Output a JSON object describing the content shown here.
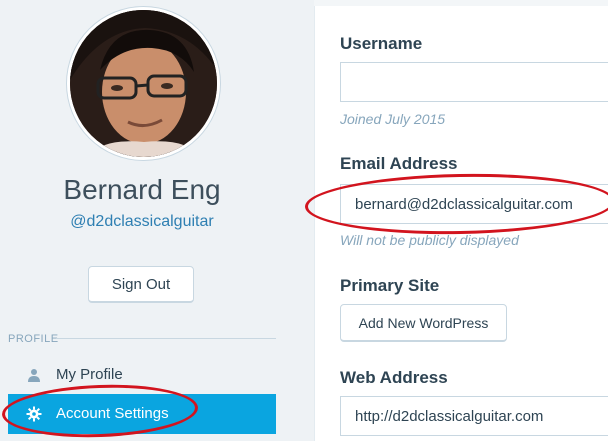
{
  "profile": {
    "display_name": "Bernard Eng",
    "handle": "@d2dclassicalguitar",
    "sign_out_label": "Sign Out"
  },
  "sidebar": {
    "section_label": "PROFILE",
    "items": [
      {
        "label": "My Profile",
        "icon": "person-icon"
      },
      {
        "label": "Account Settings",
        "icon": "gear-icon",
        "active": true
      }
    ]
  },
  "form": {
    "username": {
      "label": "Username",
      "value": "",
      "hint": "Joined July 2015"
    },
    "email": {
      "label": "Email Address",
      "value": "bernard@d2dclassicalguitar.com",
      "hint": "Will not be publicly displayed"
    },
    "primary_site": {
      "label": "Primary Site",
      "button_label": "Add New WordPress"
    },
    "web_address": {
      "label": "Web Address",
      "value": "http://d2dclassicalguitar.com"
    }
  },
  "colors": {
    "accent": "#0aa5e0",
    "link": "#2e7fb2",
    "annotation": "#d2141e"
  }
}
